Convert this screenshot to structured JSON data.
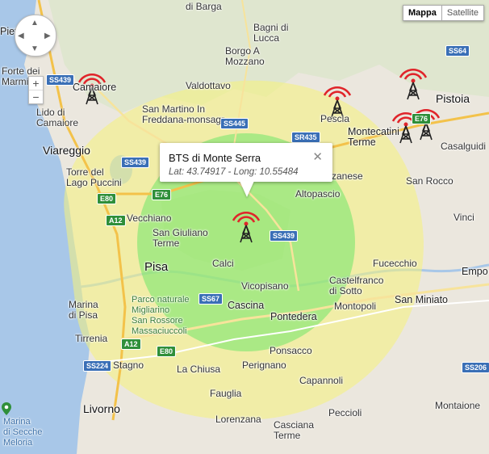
{
  "map_type": {
    "active": "Mappa",
    "inactive": "Satellite"
  },
  "zoom": {
    "in": "+",
    "out": "−"
  },
  "pan": {
    "up": "▲",
    "down": "▼",
    "left": "◀",
    "right": "▶"
  },
  "info_window": {
    "title": "BTS di Monte Serra",
    "coords": "Lat: 43.74917 - Long: 10.55484",
    "close": "✕"
  },
  "colors": {
    "sea": "#a7c6e6",
    "land": "#e9e5dc",
    "coverage_outer": "#f6f39a",
    "coverage_inner": "#8fe88a",
    "tower": "#222222",
    "signal": "#e0242a"
  },
  "towers": [
    "Camaiore",
    "Pescia",
    "Pistoia",
    "Montecatini",
    "Montecatini-2",
    "Monte Serra"
  ],
  "labels": {
    "pietrasanta": "Pietrasanta",
    "forte": "Forte dei\nMarmi",
    "camaiore": "Camaiore",
    "lido": "Lido di\nCamaiore",
    "viareggio": "Viareggio",
    "torre": "Torre del\nLago Puccini",
    "barga": "di Barga",
    "bagni": "Bagni di\nLucca",
    "borgo": "Borgo A\nMozzano",
    "valdottavo": "Valdottavo",
    "sanmartino": "San Martino In\nFreddana-monsagr",
    "pescia": "Pescia",
    "montecatini": "Montecatini\nTerme",
    "pistoia": "Pistoia",
    "casalguidi": "Casalguidi",
    "sanrocco": "San Rocco",
    "altopascio": "Altopascio",
    "zanese": "zanese",
    "vecchiano": "Vecchiano",
    "sangiuliano": "San Giuliano\nTerme",
    "calci": "Calci",
    "pisa": "Pisa",
    "vicopisano": "Vicopisano",
    "cascina": "Cascina",
    "pontedera": "Pontedera",
    "castelfranco": "Castelfranco\ndi Sotto",
    "montopoli": "Montopoli",
    "fucecchio": "Fucecchio",
    "vinci": "Vinci",
    "empoli": "Empo",
    "sanminiato": "San Miniato",
    "parco": "Parco naturale\nMigliarino\nSan Rossore\nMassaciuccoli",
    "marina": "Marina\ndi Pisa",
    "tirrenia": "Tirrenia",
    "stagno": "Stagno",
    "lachiusa": "La Chiusa",
    "ponsacco": "Ponsacco",
    "perignano": "Perignano",
    "capannoli": "Capannoli",
    "livorno": "Livorno",
    "fauglia": "Fauglia",
    "lorenzana": "Lorenzana",
    "cascianaterme": "Casciana\nTerme",
    "peccioli": "Peccioli",
    "montaione": "Montaione",
    "secche": "Marina\ndi Secche\nMeloria"
  },
  "roads": {
    "ss439a": "SS439",
    "ss439b": "SS439",
    "ss439c": "SS439",
    "ss445": "SS445",
    "sr435": "SR435",
    "ss64": "SS64",
    "e76a": "E76",
    "e76b": "E76",
    "e80a": "E80",
    "e80b": "E80",
    "a12a": "A12",
    "a12b": "A12",
    "ss67": "SS67",
    "ss224": "SS224",
    "ss206": "SS206"
  }
}
